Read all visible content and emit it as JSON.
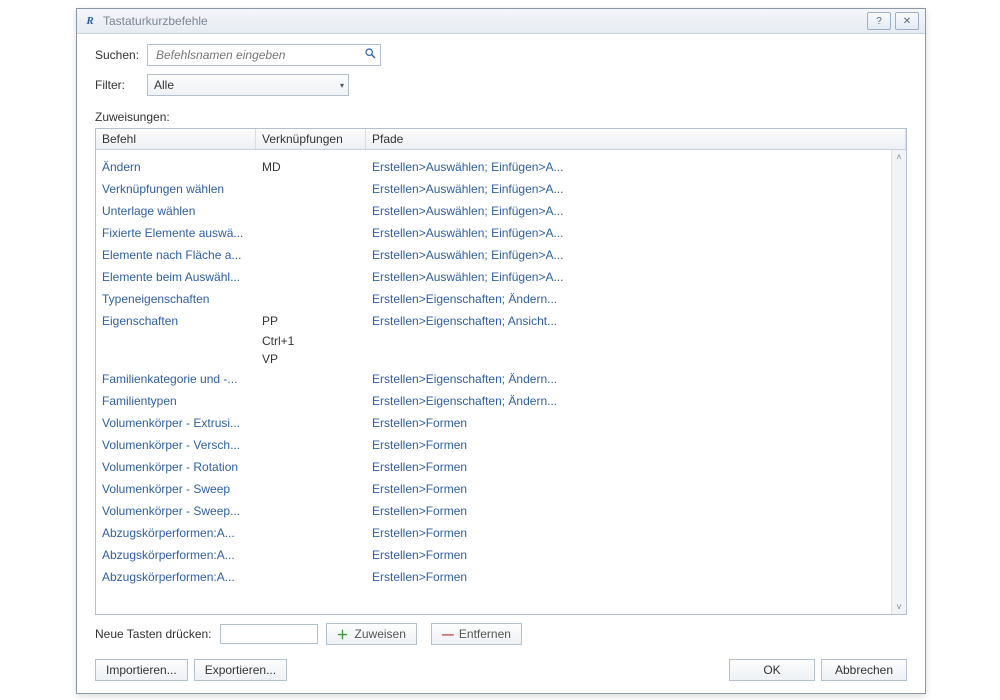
{
  "window": {
    "title": "Tastaturkurzbefehle",
    "help_tooltip": "?",
    "close_tooltip": "✕"
  },
  "search": {
    "label": "Suchen:",
    "placeholder": "Befehlsnamen eingeben"
  },
  "filter": {
    "label": "Filter:",
    "value": "Alle"
  },
  "assignments_label": "Zuweisungen:",
  "columns": {
    "command": "Befehl",
    "shortcuts": "Verknüpfungen",
    "paths": "Pfade"
  },
  "rows": [
    {
      "command": "Ändern",
      "shortcuts": [
        "MD"
      ],
      "path": "Erstellen>Auswählen; Einfügen>A..."
    },
    {
      "command": "Verknüpfungen wählen",
      "shortcuts": [],
      "path": "Erstellen>Auswählen; Einfügen>A..."
    },
    {
      "command": "Unterlage wählen",
      "shortcuts": [],
      "path": "Erstellen>Auswählen; Einfügen>A..."
    },
    {
      "command": "Fixierte Elemente auswä...",
      "shortcuts": [],
      "path": "Erstellen>Auswählen; Einfügen>A..."
    },
    {
      "command": "Elemente nach Fläche a...",
      "shortcuts": [],
      "path": "Erstellen>Auswählen; Einfügen>A..."
    },
    {
      "command": "Elemente beim Auswähl...",
      "shortcuts": [],
      "path": "Erstellen>Auswählen; Einfügen>A..."
    },
    {
      "command": "Typeneigenschaften",
      "shortcuts": [],
      "path": "Erstellen>Eigenschaften; Ändern..."
    },
    {
      "command": "Eigenschaften",
      "shortcuts": [
        "PP",
        "Ctrl+1",
        "VP"
      ],
      "path": "Erstellen>Eigenschaften; Ansicht..."
    },
    {
      "command": "Familienkategorie und -...",
      "shortcuts": [],
      "path": "Erstellen>Eigenschaften; Ändern..."
    },
    {
      "command": "Familientypen",
      "shortcuts": [],
      "path": "Erstellen>Eigenschaften; Ändern..."
    },
    {
      "command": "Volumenkörper - Extrusi...",
      "shortcuts": [],
      "path": "Erstellen>Formen"
    },
    {
      "command": "Volumenkörper - Versch...",
      "shortcuts": [],
      "path": "Erstellen>Formen"
    },
    {
      "command": "Volumenkörper - Rotation",
      "shortcuts": [],
      "path": "Erstellen>Formen"
    },
    {
      "command": "Volumenkörper - Sweep",
      "shortcuts": [],
      "path": "Erstellen>Formen"
    },
    {
      "command": "Volumenkörper - Sweep...",
      "shortcuts": [],
      "path": "Erstellen>Formen"
    },
    {
      "command": "Abzugskörperformen:A...",
      "shortcuts": [],
      "path": "Erstellen>Formen"
    },
    {
      "command": "Abzugskörperformen:A...",
      "shortcuts": [],
      "path": "Erstellen>Formen"
    },
    {
      "command": "Abzugskörperformen:A...",
      "shortcuts": [],
      "path": "Erstellen>Formen"
    }
  ],
  "press_keys": {
    "label": "Neue Tasten drücken:",
    "assign": "Zuweisen",
    "remove": "Entfernen"
  },
  "buttons": {
    "import": "Importieren...",
    "export": "Exportieren...",
    "ok": "OK",
    "cancel": "Abbrechen"
  }
}
